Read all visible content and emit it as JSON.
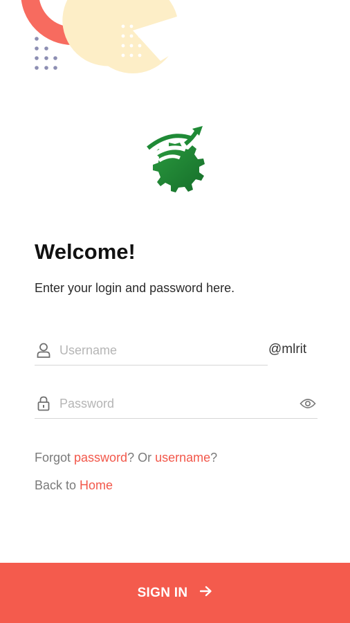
{
  "header": {
    "title": "Welcome!",
    "subtitle": "Enter your login and password here."
  },
  "form": {
    "username": {
      "placeholder": "Username",
      "value": "",
      "icon": "user-icon",
      "suffix": "@mlrit"
    },
    "password": {
      "placeholder": "Password",
      "value": "",
      "icon": "lock-icon",
      "toggle_icon": "eye-icon"
    }
  },
  "links": {
    "forgot_prefix": "Forgot ",
    "forgot_password": "password",
    "forgot_middle": "? Or ",
    "forgot_username": "username",
    "forgot_suffix": "?",
    "back_prefix": "Back to ",
    "home": "Home"
  },
  "actions": {
    "signin_label": "SIGN IN",
    "signin_icon": "arrow-right-icon"
  },
  "colors": {
    "accent": "#f45b4d",
    "logo_green": "#1e8a34",
    "deco_coral": "#f76b5f",
    "deco_cream": "#fdeec7",
    "deco_dots": "#8d8fb3"
  }
}
